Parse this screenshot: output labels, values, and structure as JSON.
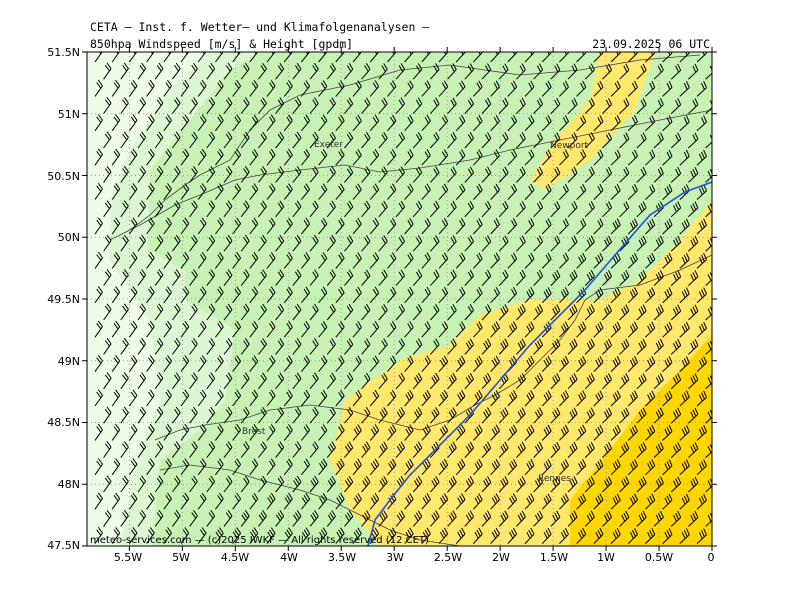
{
  "header": {
    "line1": "CETA — Inst. f. Wetter— und Klimafolgenanalysen —",
    "line2": "850hpa Windspeed [m/s] & Height [gpdm]",
    "datetime": "23.09.2025 06 UTC"
  },
  "axes": {
    "y_ticks": [
      "51.5N",
      "51N",
      "50.5N",
      "50N",
      "49.5N",
      "49N",
      "48.5N",
      "48N",
      "47.5N"
    ],
    "x_ticks": [
      "5.5W",
      "5W",
      "4.5W",
      "4W",
      "3.5W",
      "3W",
      "2.5W",
      "2W",
      "1.5W",
      "1W",
      "0.5W",
      "0"
    ],
    "lat_range": [
      47.5,
      51.5
    ],
    "lon_range": [
      -5.9,
      0
    ]
  },
  "cities": [
    "Exeter",
    "Newport",
    "Brest",
    "Rennes"
  ],
  "footer": "meteo-services.com — (c)2025 IWKF — All rights reserved (12 CET)",
  "colors": {
    "speed_lightest": "#eefbe9",
    "speed_light": "#dcf7d2",
    "speed_green": "#c7f2b4",
    "speed_yellow": "#ffe86c",
    "speed_gold": "#ffd700",
    "height_contour": "#2255dd",
    "wind_barb": "#000000"
  },
  "wind_barbs": "wind barbs from the WSW over the whole domain, stronger (more flags) in the southeast"
}
